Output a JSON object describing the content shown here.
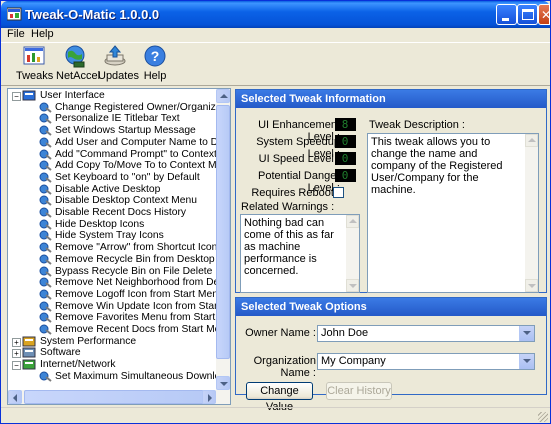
{
  "window": {
    "title": "Tweak-O-Matic 1.0.0.0"
  },
  "menu": [
    {
      "label": "File",
      "accel": "F"
    },
    {
      "label": "Help",
      "accel": "H"
    }
  ],
  "toolbar": [
    {
      "label": "Tweaks",
      "icon": "tweaks-icon"
    },
    {
      "label": "NetAccel",
      "icon": "netaccel-icon"
    },
    {
      "label": "Updates",
      "icon": "updates-icon"
    },
    {
      "label": "Help",
      "icon": "help-icon"
    }
  ],
  "tree": {
    "categories": [
      {
        "label": "User Interface",
        "expanded": true,
        "items": [
          "Change Registered Owner/Organization",
          "Personalize IE Titlebar Text",
          "Set Windows Startup Message",
          "Add User and Computer Name to Desktop",
          "Add \"Command Prompt\" to Context Menu",
          "Add Copy To/Move To to Context Menu",
          "Set Keyboard to \"on\" by Default",
          "Disable Active Desktop",
          "Disable Desktop Context Menu",
          "Disable Recent Docs History",
          "Hide Desktop Icons",
          "Hide System Tray Icons",
          "Remove \"Arrow\" from Shortcut Icon(s)",
          "Remove Recycle Bin from Desktop",
          "Bypass Recycle Bin on File Delete",
          "Remove Net Neighborhood from Desktop",
          "Remove Logoff Icon from Start Menu",
          "Remove Win Update Icon from Start Menu",
          "Remove Favorites Menu from Start Menu",
          "Remove Recent Docs from Start Menu"
        ]
      },
      {
        "label": "System Performance",
        "expanded": false,
        "items": []
      },
      {
        "label": "Software",
        "expanded": false,
        "items": []
      },
      {
        "label": "Internet/Network",
        "expanded": true,
        "items": [
          "Set Maximum Simultaneous Downloads"
        ]
      }
    ]
  },
  "info_panel": {
    "heading": "Selected Tweak Information",
    "levels": [
      {
        "label": "UI Enhancement Level :",
        "value": "8"
      },
      {
        "label": "System Speedup Level :",
        "value": "0"
      },
      {
        "label": "UI Speed Level :",
        "value": "0"
      },
      {
        "label": "Potential Danger Level :",
        "value": "0"
      }
    ],
    "requires_reboot_label": "Requires Reboot :",
    "requires_reboot": false,
    "warnings_label": "Related Warnings :",
    "warnings_text": "Nothing bad can come of this as far as machine performance is concerned.",
    "description_label": "Tweak Description :",
    "description_text": "This tweak allows you to change the name and company of the Registered User/Company for the machine."
  },
  "options_panel": {
    "heading": "Selected Tweak Options",
    "owner_label": "Owner Name :",
    "owner_value": "John Doe",
    "org_label": "Organization Name :",
    "org_value": "My Company",
    "change_button": "Change Value",
    "clear_button": "Clear History"
  },
  "colors": {
    "panel_header": "#2f6bd9",
    "lcd_text": "#1f7d2c",
    "titlebar": "#0b62e7"
  }
}
